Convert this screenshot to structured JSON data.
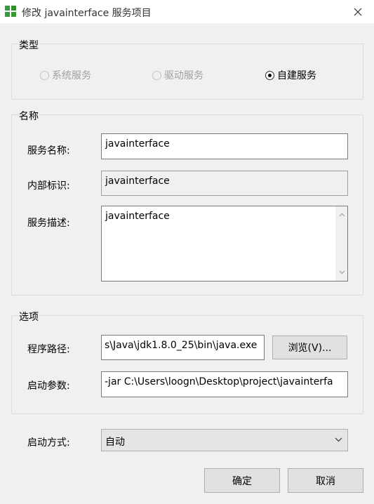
{
  "window": {
    "title": "修改 javainterface 服务项目",
    "close_glyph": "close-icon"
  },
  "type_group": {
    "legend": "类型",
    "options": [
      {
        "label": "系统服务",
        "checked": false,
        "enabled": false
      },
      {
        "label": "驱动服务",
        "checked": false,
        "enabled": false
      },
      {
        "label": "自建服务",
        "checked": true,
        "enabled": true
      }
    ]
  },
  "name_group": {
    "legend": "名称",
    "service_name_label": "服务名称:",
    "service_name_value": "javainterface",
    "internal_id_label": "内部标识:",
    "internal_id_value": "javainterface",
    "description_label": "服务描述:",
    "description_value": "javainterface"
  },
  "options_group": {
    "legend": "选项",
    "program_path_label": "程序路径:",
    "program_path_value": "s\\Java\\jdk1.8.0_25\\bin\\java.exe",
    "browse_label": "浏览(V)...",
    "start_params_label": "启动参数:",
    "start_params_value": "-jar C:\\Users\\loogn\\Desktop\\project\\javainterfa"
  },
  "startup": {
    "label": "启动方式:",
    "selected": "自动"
  },
  "footer": {
    "ok_label": "确定",
    "cancel_label": "取消"
  },
  "colors": {
    "window_bg": "#f0f0f0",
    "titlebar_bg": "#ffffff",
    "icon_green": "#3a9a3a",
    "disabled_text": "#a0a0a0"
  }
}
